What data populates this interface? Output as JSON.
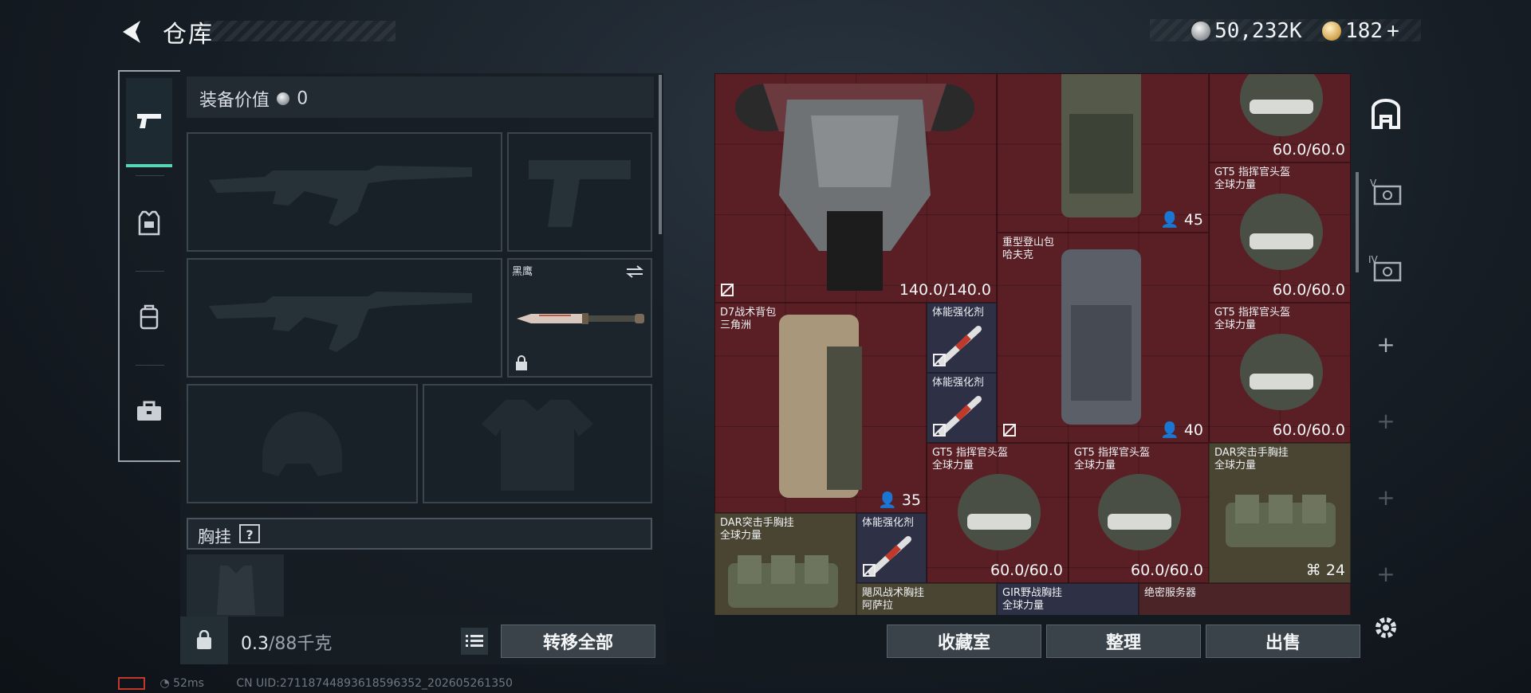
{
  "header": {
    "title": "仓库",
    "currency_silver": "50,232K",
    "currency_gold": "182",
    "add_label": "+"
  },
  "equipment": {
    "value_label": "装备价值",
    "value": "0",
    "knife_name": "黑鹰",
    "chest_rig_label": "胸挂",
    "help_label": "?"
  },
  "footer_left": {
    "weight_current": "0.3",
    "weight_max": "/88千克",
    "transfer_all": "转移全部"
  },
  "footer_right": {
    "collection_room": "收藏室",
    "organize": "整理",
    "sell": "出售"
  },
  "grid_items": [
    {
      "key": "armor",
      "name": "",
      "value": "140.0/140.0"
    },
    {
      "key": "backpack_top",
      "name": "",
      "count": "45"
    },
    {
      "key": "helmet_top",
      "name": "",
      "value": "60.0/60.0"
    },
    {
      "key": "helmet_r1",
      "name": "GT5 指挥官头盔\n全球力量",
      "value": "60.0/60.0"
    },
    {
      "key": "heavy_pack",
      "name": "重型登山包\n哈夫克",
      "count": "40"
    },
    {
      "key": "helmet_r2",
      "name": "GT5 指挥官头盔\n全球力量",
      "value": "60.0/60.0"
    },
    {
      "key": "d7_pack",
      "name": "D7战术背包\n三角洲",
      "count": "35"
    },
    {
      "key": "stim1",
      "name": "体能强化剂"
    },
    {
      "key": "stim2",
      "name": "体能强化剂"
    },
    {
      "key": "helmet_b1",
      "name": "GT5 指挥官头盔\n全球力量",
      "value": "60.0/60.0"
    },
    {
      "key": "helmet_b2",
      "name": "GT5 指挥官头盔\n全球力量",
      "value": "60.0/60.0"
    },
    {
      "key": "dar_rig_r",
      "name": "DAR突击手胸挂\n全球力量",
      "count": "24"
    },
    {
      "key": "dar_rig_l",
      "name": "DAR突击手胸挂\n全球力量"
    },
    {
      "key": "stim3",
      "name": "体能强化剂"
    },
    {
      "key": "wind_rig",
      "name": "飓风战术胸挂\n阿萨拉"
    },
    {
      "key": "gir_rig",
      "name": "GIR野战胸挂\n全球力量"
    },
    {
      "key": "server",
      "name": "绝密服务器"
    }
  ],
  "status_bar": {
    "ping": "52ms",
    "uid": "CN UID:27118744893618596352_202605261350"
  },
  "colors": {
    "grid_red": "#5a1f25",
    "accent_teal": "#57d6b6",
    "slot_purple": "#2e3046"
  },
  "icons": {
    "back": "back-arrow-icon",
    "silver": "silver-coin-icon",
    "gold": "gold-coin-icon",
    "settings": "gear-icon"
  }
}
